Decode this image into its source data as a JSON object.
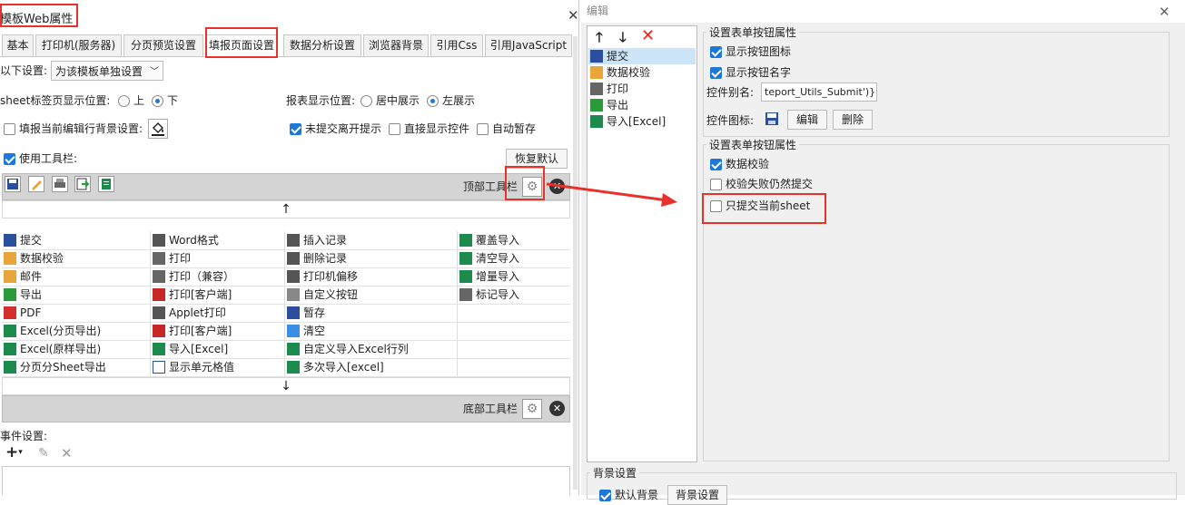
{
  "left": {
    "title": "模板Web属性",
    "tabs": [
      "基本",
      "打印机(服务器)",
      "分页预览设置",
      "填报页面设置",
      "数据分析设置",
      "浏览器背景",
      "引用Css",
      "引用JavaScript"
    ],
    "setting_label": "以下设置:",
    "setting_select": "为该模板单独设置",
    "sheet_pos_label": "sheet标签页显示位置:",
    "sheet_pos_options": [
      "上",
      "下"
    ],
    "report_pos_label": "报表显示位置:",
    "report_pos_options": [
      "居中展示",
      "左展示"
    ],
    "fill_bg_label": "填报当前编辑行背景设置:",
    "unsubmit_label": "未提交离开提示",
    "direct_show_label": "直接显示控件",
    "autosave_label": "自动暂存",
    "use_toolbar_label": "使用工具栏:",
    "restore_default": "恢复默认",
    "top_toolbar_label": "顶部工具栏",
    "bottom_toolbar_label": "底部工具栏",
    "up_arrow": "↑",
    "down_arrow": "↓",
    "grid": [
      [
        "提交",
        "Word格式",
        "插入记录",
        "覆盖导入"
      ],
      [
        "数据校验",
        "打印",
        "删除记录",
        "清空导入"
      ],
      [
        "邮件",
        "打印（兼容）",
        "打印机偏移",
        "增量导入"
      ],
      [
        "导出",
        "打印[客户端]",
        "自定义按钮",
        "标记导入"
      ],
      [
        "PDF",
        "Applet打印",
        "暂存",
        ""
      ],
      [
        "Excel(分页导出)",
        "打印[客户端]",
        "清空",
        ""
      ],
      [
        "Excel(原样导出)",
        "导入[Excel]",
        "自定义导入Excel行列",
        ""
      ],
      [
        "分页分Sheet导出",
        "显示单元格值",
        "多次导入[excel]",
        ""
      ]
    ],
    "event_label": "事件设置:"
  },
  "right": {
    "title": "编辑",
    "list": [
      "提交",
      "数据校验",
      "打印",
      "导出",
      "导入[Excel]"
    ],
    "group1_title": "设置表单按钮属性",
    "show_icon_label": "显示按钮图标",
    "show_name_label": "显示按钮名字",
    "alias_label": "控件别名:",
    "alias_value": "teport_Utils_Submit')}",
    "icon_label": "控件图标:",
    "edit_btn": "编辑",
    "delete_btn": "删除",
    "group2_title": "设置表单按钮属性",
    "data_check_label": "数据校验",
    "fail_submit_label": "校验失败仍然提交",
    "submit_sheet_label": "只提交当前sheet",
    "bg_group_title": "背景设置",
    "default_bg_label": "默认背景",
    "bg_settings_btn": "背景设置"
  },
  "colors": {
    "accent": "#1e78d7",
    "annotation": "#e8312a",
    "toolbar_bg": "#d4d4d4",
    "selected": "#cce4f7"
  }
}
